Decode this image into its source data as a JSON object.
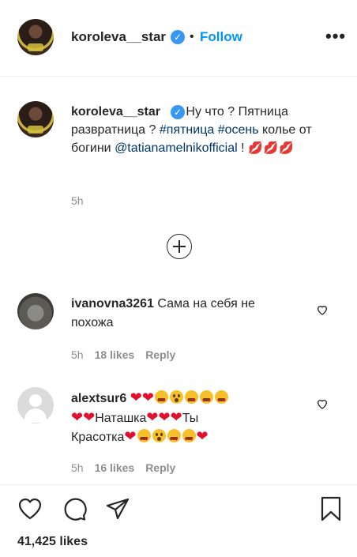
{
  "post": {
    "username": "koroleva__star",
    "follow_label": "Follow",
    "more_label": "•••",
    "separator": "•"
  },
  "caption": {
    "username": "koroleva__star",
    "text_1": "Ну что ? Пятница развратница ?",
    "hashtag_1": "#пятница",
    "hashtag_2": "#осень",
    "text_2": "колье от богини",
    "mention": "@tatianamelnikofficial",
    "text_3": "!",
    "emojis": "💋💋💋",
    "time": "5h"
  },
  "comments": [
    {
      "username": "ivanovna3261",
      "text_line_1": "Сама на себя не",
      "text_line_2": "похожа",
      "time": "5h",
      "likes": "18 likes",
      "reply": "Reply"
    },
    {
      "username": "alextsur6",
      "word_1": "Наташка",
      "word_2": "Ты",
      "word_3": "Красотка",
      "time": "5h",
      "likes": "16 likes",
      "reply": "Reply"
    }
  ],
  "footer": {
    "likes_count": "41,425 likes"
  },
  "icons": [
    "verified-icon",
    "more-options-icon",
    "load-more-comments-icon",
    "comment-like-icon",
    "heart-icon",
    "comment-icon",
    "share-icon",
    "bookmark-icon"
  ],
  "colors": {
    "link": "#00376b",
    "follow": "#0095f6",
    "verified": "#3897f0",
    "heart": "#e0102e",
    "muted": "#8e8e8e"
  }
}
